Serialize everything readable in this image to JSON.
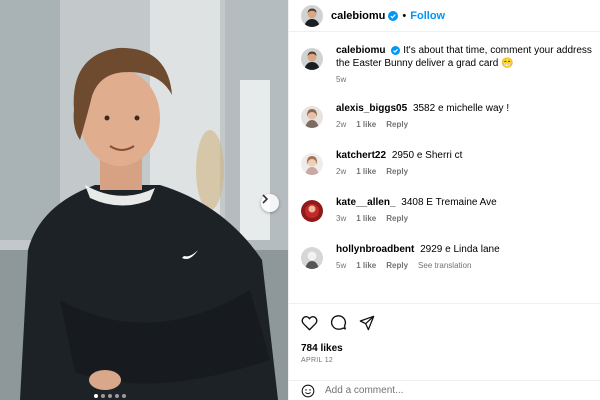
{
  "post": {
    "author": "calebiomu",
    "follow_label": "Follow",
    "separator": "•",
    "caption": {
      "username": "calebiomu",
      "text_line1": "It's about that time, comment your address to",
      "text_line2": "the Easter Bunny deliver a grad card 😁",
      "time": "5w"
    }
  },
  "comments": [
    {
      "username": "alexis_biggs05",
      "text": "3582 e michelle way !",
      "time": "2w",
      "likes": "1 like",
      "reply": "Reply",
      "extra": ""
    },
    {
      "username": "katchert22",
      "text": "2950 e Sherri ct",
      "time": "2w",
      "likes": "1 like",
      "reply": "Reply",
      "extra": ""
    },
    {
      "username": "kate__allen_",
      "text": "3408 E Tremaine Ave",
      "time": "3w",
      "likes": "1 like",
      "reply": "Reply",
      "extra": ""
    },
    {
      "username": "hollynbroadbent",
      "text": "2929 e Linda lane",
      "time": "5w",
      "likes": "1 like",
      "reply": "Reply",
      "extra": "See translation"
    }
  ],
  "engagement": {
    "likes": "784 likes",
    "date": "APRIL 12"
  },
  "composer": {
    "placeholder": "Add a comment..."
  },
  "icons": [
    "verified-badge-icon",
    "heart-icon",
    "comment-icon",
    "share-icon",
    "emoji-icon",
    "chevron-right-icon"
  ],
  "colors": {
    "link": "#0095f6",
    "muted": "#737373",
    "divider": "#efefef"
  }
}
